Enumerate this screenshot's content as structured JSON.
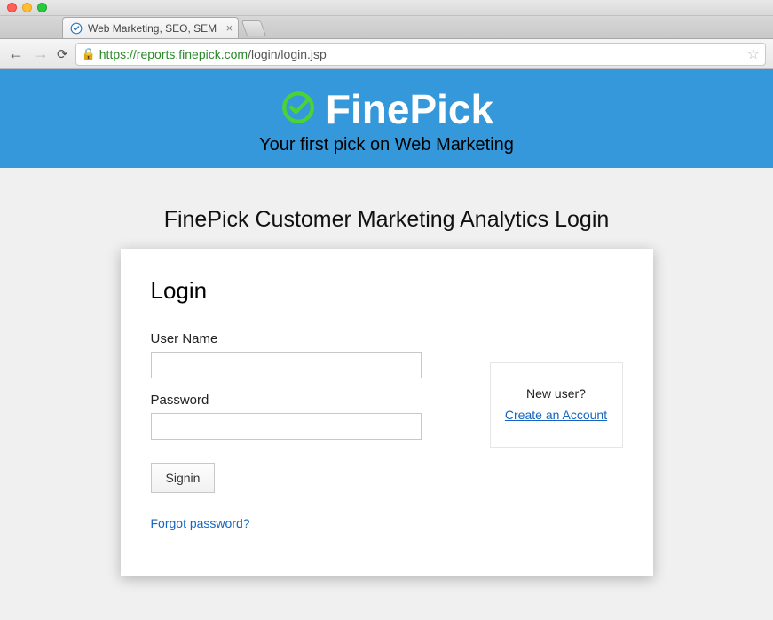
{
  "browser": {
    "tab_title": "Web Marketing, SEO, SEM",
    "url_scheme": "https",
    "url_host": "://reports.finepick.com",
    "url_path": "/login/login.jsp"
  },
  "header": {
    "brand": "FinePick",
    "tagline": "Your first pick on Web Marketing"
  },
  "page": {
    "title": "FinePick Customer Marketing Analytics Login"
  },
  "login": {
    "heading": "Login",
    "username_label": "User Name",
    "username_value": "",
    "password_label": "Password",
    "password_value": "",
    "submit_label": "Signin",
    "forgot_label": "Forgot password?"
  },
  "signup": {
    "prompt": "New user?",
    "link_label": "Create an Account"
  }
}
